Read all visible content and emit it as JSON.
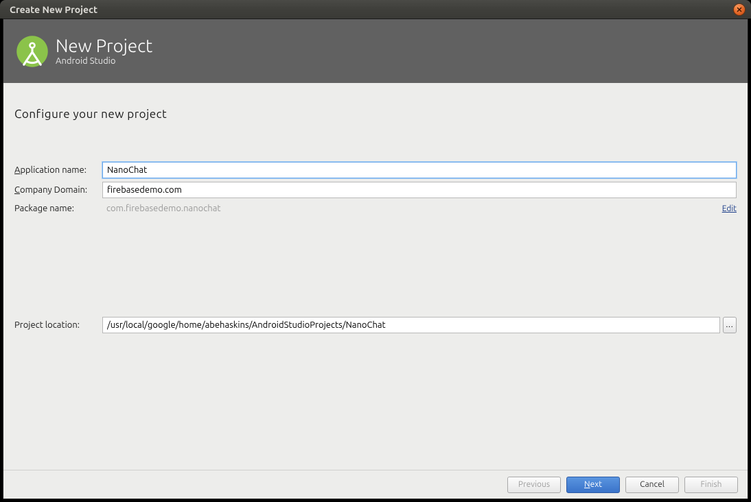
{
  "window": {
    "title": "Create New Project"
  },
  "header": {
    "title": "New Project",
    "subtitle": "Android Studio"
  },
  "section_title": "Configure your new project",
  "form": {
    "app_name": {
      "label_pre": "A",
      "label_mn": "pplication name:",
      "value": "NanoChat"
    },
    "company": {
      "label_pre": "C",
      "label_mn": "ompany Domain:",
      "value": "firebasedemo.com"
    },
    "package": {
      "label": "Package name:",
      "value": "com.firebasedemo.nanochat",
      "edit": "Edit"
    },
    "location": {
      "label": "Project location:",
      "value": "/usr/local/google/home/abehaskins/AndroidStudioProjects/NanoChat",
      "browse": "..."
    }
  },
  "footer": {
    "previous": "Previous",
    "next_mn": "N",
    "next_rest": "ext",
    "cancel": "Cancel",
    "finish": "Finish"
  }
}
